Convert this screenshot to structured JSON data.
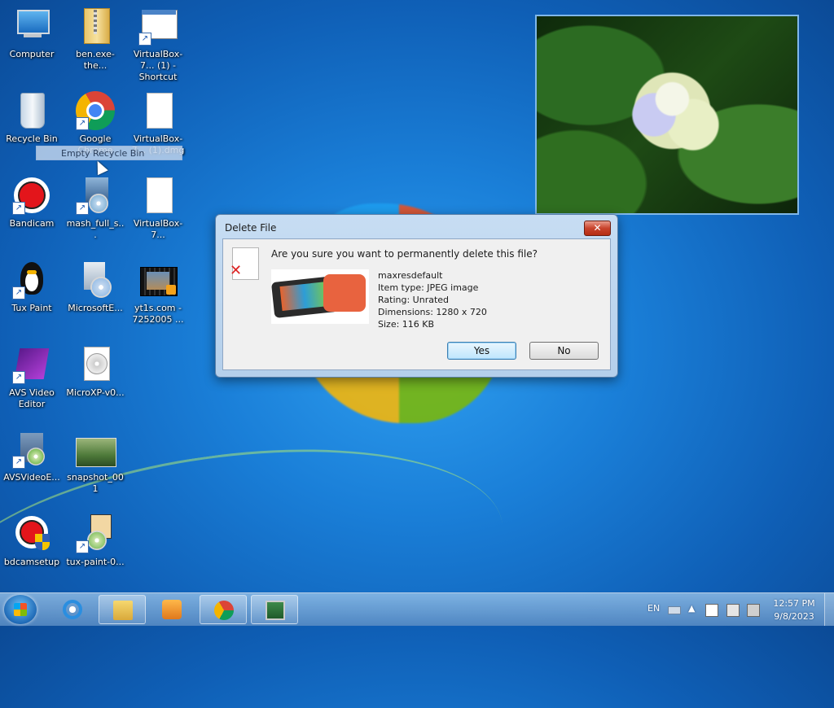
{
  "desktop": {
    "icons": [
      {
        "label": "Computer"
      },
      {
        "label": "ben.exe-the..."
      },
      {
        "label": "VirtualBox-7... (1) - Shortcut"
      },
      {
        "label": "Recycle Bin"
      },
      {
        "label": "Google Chrome"
      },
      {
        "label": "VirtualBox-7... (1).dmg"
      },
      {
        "label": "Bandicam"
      },
      {
        "label": "mash_full_s..."
      },
      {
        "label": "VirtualBox-7..."
      },
      {
        "label": "Tux Paint"
      },
      {
        "label": "MicrosoftE..."
      },
      {
        "label": "yt1s.com - 7252005 ..."
      },
      {
        "label": "AVS Video Editor"
      },
      {
        "label": "MicroXP-v0..."
      },
      {
        "label": "AVSVideoE..."
      },
      {
        "label": "snapshot_001"
      },
      {
        "label": "bdcamsetup"
      },
      {
        "label": "tux-paint-0..."
      }
    ],
    "tooltip": "Empty Recycle Bin"
  },
  "dialog": {
    "title": "Delete File",
    "close_label": "✕",
    "question": "Are you sure you want to permanently delete this file?",
    "file": {
      "name": "maxresdefault",
      "type": "Item type: JPEG image",
      "rating": "Rating: Unrated",
      "dimensions": "Dimensions: 1280 x 720",
      "size": "Size: 116 KB"
    },
    "yes_label": "Yes",
    "no_label": "No"
  },
  "taskbar": {
    "language": "EN",
    "time": "12:57 PM",
    "date": "9/8/2023"
  }
}
